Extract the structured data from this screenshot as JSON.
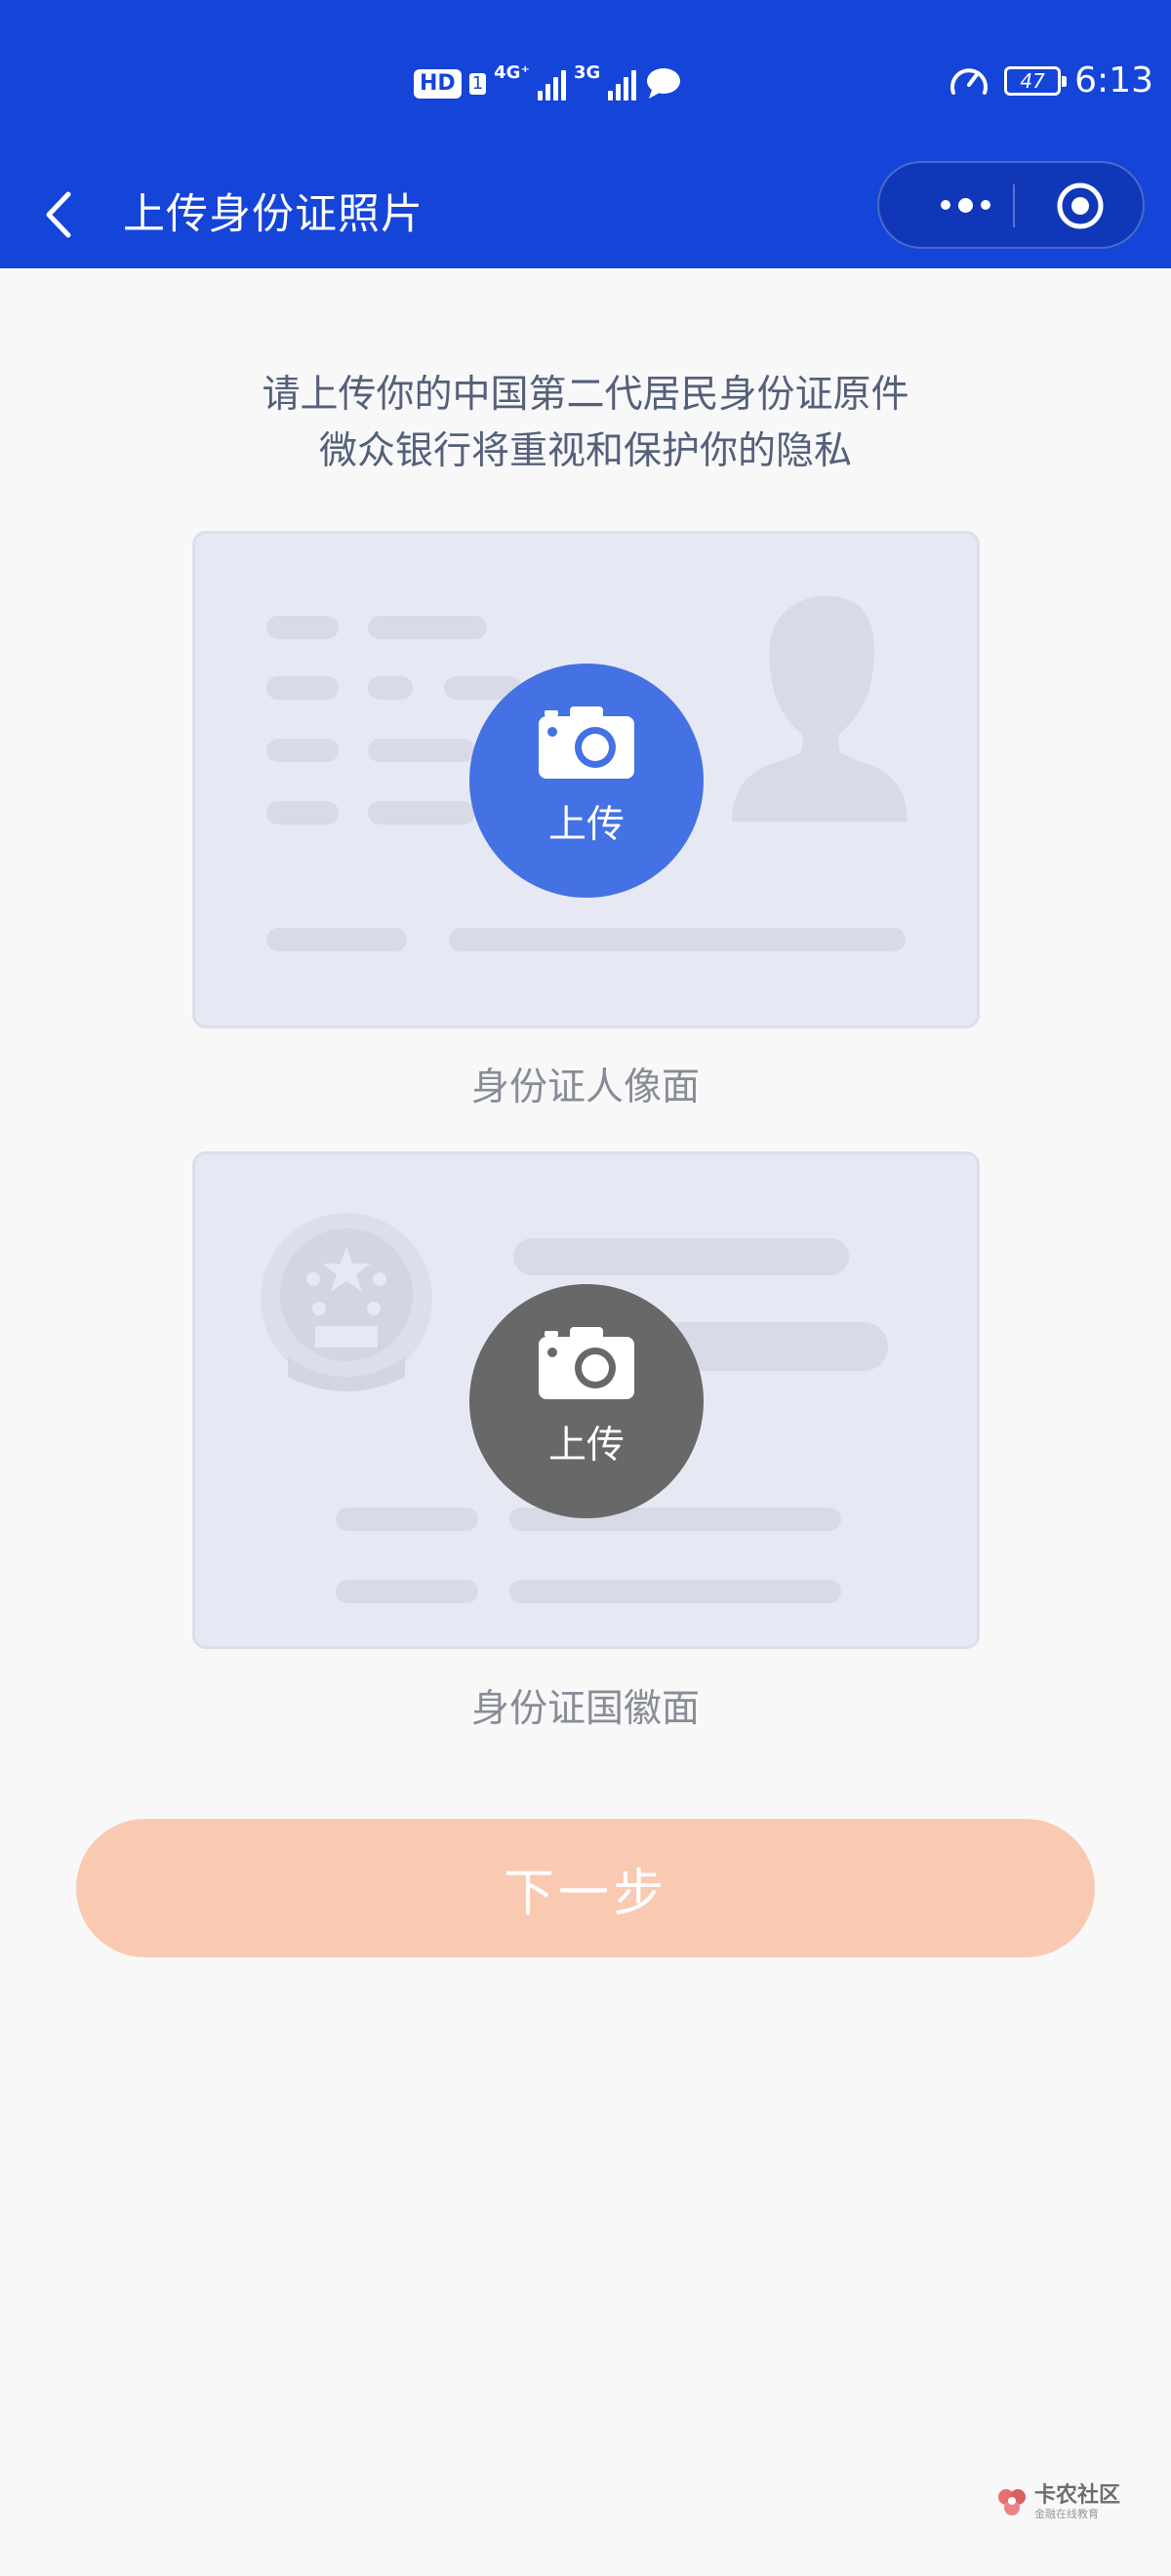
{
  "status_bar": {
    "hd_label": "HD",
    "sim_label": "1",
    "net1_label": "4G⁺",
    "net2_label": "3G",
    "battery": "47",
    "time": "6:13"
  },
  "nav": {
    "title": "上传身份证照片",
    "back_icon": "chevron-left-icon",
    "more_icon": "more-dots-icon",
    "close_icon": "target-circle-icon"
  },
  "intro": {
    "line1": "请上传你的中国第二代居民身份证原件",
    "line2": "微众银行将重视和保护你的隐私"
  },
  "cards": [
    {
      "upload_label": "上传",
      "caption": "身份证人像面",
      "button_color": "#4471e3"
    },
    {
      "upload_label": "上传",
      "caption": "身份证国徽面",
      "button_color": "#686868"
    }
  ],
  "next_button": {
    "label": "下一步",
    "color": "#f9c9b2"
  },
  "watermark": {
    "main": "卡农社区",
    "sub": "金融在线教育"
  },
  "colors": {
    "brand": "#1544d9",
    "background": "#f8f8f9"
  }
}
